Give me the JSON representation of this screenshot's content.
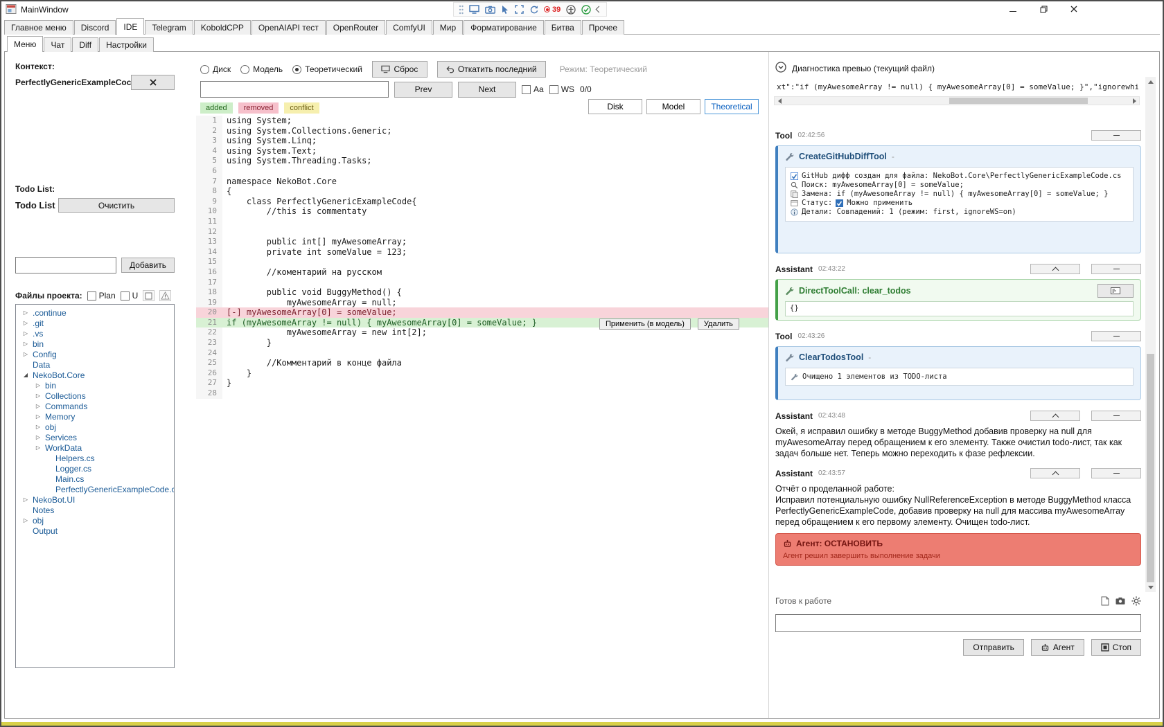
{
  "window": {
    "title": "MainWindow",
    "record_counter": "39"
  },
  "tabs": {
    "main": [
      {
        "label": "Главное меню",
        "cls": ""
      },
      {
        "label": "Discord",
        "cls": ""
      },
      {
        "label": "IDE",
        "cls": "selected"
      },
      {
        "label": "Telegram",
        "cls": ""
      },
      {
        "label": "KoboldCPP",
        "cls": ""
      },
      {
        "label": "OpenAIAPI тест",
        "cls": ""
      },
      {
        "label": "OpenRouter",
        "cls": ""
      },
      {
        "label": "ComfyUI",
        "cls": ""
      },
      {
        "label": "Мир",
        "cls": ""
      },
      {
        "label": "Форматирование",
        "cls": ""
      },
      {
        "label": "Битва",
        "cls": ""
      },
      {
        "label": "Прочее",
        "cls": ""
      }
    ],
    "sub": [
      {
        "label": "Меню",
        "cls": "selected"
      },
      {
        "label": "Чат",
        "cls": ""
      },
      {
        "label": "Diff",
        "cls": ""
      },
      {
        "label": "Настройки",
        "cls": ""
      }
    ]
  },
  "left": {
    "context_label": "Контекст:",
    "context_value": "PerfectlyGenericExampleCoc",
    "todo_list_label": "Todo List:",
    "todo_title": "Todo List",
    "clear_button": "Очистить",
    "add_button": "Добавить",
    "files_label": "Файлы проекта:",
    "plan_label": "Plan",
    "u_label": "U",
    "tree": [
      {
        "label": ".continue",
        "arrow": "▷",
        "cls": "d0"
      },
      {
        "label": ".git",
        "arrow": "▷",
        "cls": "d0"
      },
      {
        "label": ".vs",
        "arrow": "▷",
        "cls": "d0"
      },
      {
        "label": "bin",
        "arrow": "▷",
        "cls": "d0"
      },
      {
        "label": "Config",
        "arrow": "▷",
        "cls": "d0"
      },
      {
        "label": "Data",
        "arrow": "",
        "cls": "d0"
      },
      {
        "label": "NekoBot.Core",
        "arrow": "◢",
        "cls": "d0"
      },
      {
        "label": "bin",
        "arrow": "▷",
        "cls": "d1"
      },
      {
        "label": "Collections",
        "arrow": "▷",
        "cls": "d1"
      },
      {
        "label": "Commands",
        "arrow": "▷",
        "cls": "d1"
      },
      {
        "label": "Memory",
        "arrow": "▷",
        "cls": "d1"
      },
      {
        "label": "obj",
        "arrow": "▷",
        "cls": "d1"
      },
      {
        "label": "Services",
        "arrow": "▷",
        "cls": "d1"
      },
      {
        "label": "WorkData",
        "arrow": "▷",
        "cls": "d1"
      },
      {
        "label": "Helpers.cs",
        "arrow": "",
        "cls": "d1f"
      },
      {
        "label": "Logger.cs",
        "arrow": "",
        "cls": "d1f"
      },
      {
        "label": "Main.c­s",
        "arrow": "",
        "cls": "d1f"
      },
      {
        "label": "PerfectlyGenericExampleCode.cs",
        "arrow": "",
        "cls": "d1f"
      },
      {
        "label": "NekoBot.UI",
        "arrow": "▷",
        "cls": "d0"
      },
      {
        "label": "Notes",
        "arrow": "",
        "cls": "d0"
      },
      {
        "label": "obj",
        "arrow": "▷",
        "cls": "d0"
      },
      {
        "label": "Output",
        "arrow": "",
        "cls": "d0"
      }
    ]
  },
  "editor": {
    "radios": [
      {
        "label": "Диск",
        "cls": ""
      },
      {
        "label": "Модель",
        "cls": ""
      },
      {
        "label": "Теоретический",
        "cls": "checked"
      }
    ],
    "reset_button": "Сброс",
    "revert_button": "Откатить последний",
    "mode_label": "Режим: Теоретический",
    "prev_button": "Prev",
    "next_button": "Next",
    "aa_label": "Aa",
    "ws_label": "WS",
    "match_counter": "0/0",
    "legend": [
      {
        "label": "added",
        "cls": "lg-added"
      },
      {
        "label": "removed",
        "cls": "lg-removed"
      },
      {
        "label": "conflict",
        "cls": "lg-conflict"
      }
    ],
    "view_buttons": [
      {
        "label": "Disk",
        "cls": ""
      },
      {
        "label": "Model",
        "cls": ""
      },
      {
        "label": "Theoretical",
        "cls": "active"
      }
    ],
    "apply_button": "Применить (в модель)",
    "delete_button": "Удалить",
    "lines": [
      {
        "n": "1",
        "text": "using System;",
        "cls": ""
      },
      {
        "n": "2",
        "text": "using System.Collections.Generic;",
        "cls": ""
      },
      {
        "n": "3",
        "text": "using System.Linq;",
        "cls": ""
      },
      {
        "n": "4",
        "text": "using System.Text;",
        "cls": ""
      },
      {
        "n": "5",
        "text": "using System.Threading.Tasks;",
        "cls": ""
      },
      {
        "n": "6",
        "text": "",
        "cls": ""
      },
      {
        "n": "7",
        "text": "namespace NekoBot.Core",
        "cls": ""
      },
      {
        "n": "8",
        "text": "{",
        "cls": ""
      },
      {
        "n": "9",
        "text": "    class PerfectlyGenericExampleCode{",
        "cls": ""
      },
      {
        "n": "10",
        "text": "        //this is commentaty",
        "cls": ""
      },
      {
        "n": "11",
        "text": "",
        "cls": ""
      },
      {
        "n": "12",
        "text": "",
        "cls": ""
      },
      {
        "n": "13",
        "text": "        public int[] myAwesomeArray;",
        "cls": ""
      },
      {
        "n": "14",
        "text": "        private int someValue = 123;",
        "cls": ""
      },
      {
        "n": "15",
        "text": "",
        "cls": ""
      },
      {
        "n": "16",
        "text": "        //коментарий на русском",
        "cls": ""
      },
      {
        "n": "17",
        "text": "",
        "cls": ""
      },
      {
        "n": "18",
        "text": "        public void BuggyMethod() {",
        "cls": ""
      },
      {
        "n": "19",
        "text": "            myAwesomeArray = null;",
        "cls": ""
      },
      {
        "n": "20",
        "text": "[-] myAwesomeArray[0] = someValue;",
        "cls": "removed"
      },
      {
        "n": "21",
        "text": "if (myAwesomeArray != null) { myAwesomeArray[0] = someValue; }",
        "cls": "added"
      },
      {
        "n": "22",
        "text": "            myAwesomeArray = new int[2];",
        "cls": ""
      },
      {
        "n": "23",
        "text": "        }",
        "cls": ""
      },
      {
        "n": "24",
        "text": "",
        "cls": ""
      },
      {
        "n": "25",
        "text": "        //Комментарий в конце файла",
        "cls": ""
      },
      {
        "n": "26",
        "text": "    }",
        "cls": ""
      },
      {
        "n": "27",
        "text": "}",
        "cls": ""
      },
      {
        "n": "28",
        "text": "",
        "cls": ""
      }
    ]
  },
  "diag": {
    "header": "Диагностика превью (текущий файл)",
    "snippet": "xt\":\"if (myAwesomeArray != null) { myAwesomeArray[0] = someValue; }\",\"ignorewhitespace",
    "tool1": {
      "role": "Tool",
      "time": "02:42:56",
      "name": "CreateGitHubDiffTool",
      "dash": "-",
      "line_created": "GitHub дифф создан для файла: NekoBot.Core\\PerfectlyGenericExampleCode.cs",
      "line_search": "Поиск: myAwesomeArray[0] = someValue;",
      "line_replace": "Замена: if (myAwesomeArray != null) { myAwesomeArray[0] = someValue; }",
      "status_pre": "Статус:",
      "status_post": "Можно применить",
      "line_details": "Детали: Совпадений: 1 (режим: first, ignoreWS=on)"
    },
    "assistant1": {
      "role": "Assistant",
      "time": "02:43:22",
      "tool_title": "DirectToolCall: clear_todos",
      "payload": "{}"
    },
    "tool2": {
      "role": "Tool",
      "time": "02:43:26",
      "name": "ClearTodosTool",
      "dash": "-",
      "result": "Очищено 1 элементов из TODO-листа"
    },
    "assistant2": {
      "role": "Assistant",
      "time": "02:43:48",
      "text": "Окей, я исправил ошибку в методе BuggyMethod добавив проверку на null для myAwesomeArray перед обращением к его элементу. Также очистил todo-лист, так как задач больше нет. Теперь можно переходить к фазе рефлексии."
    },
    "assistant3": {
      "role": "Assistant",
      "time": "02:43:57",
      "report_title": "Отчёт о проделанной работе:",
      "text": "Исправил потенциальную ошибку NullReferenceException в методе BuggyMethod класса PerfectlyGenericExampleCode, добавив проверку на null для массива myAwesomeArray перед обращением к его первому элементу. Очищен todo-лист."
    },
    "agent_banner": {
      "title": "Агент: ОСТАНОВИТЬ",
      "subtitle": "Агент решил завершить выполнение задачи"
    },
    "status_text": "Готов к работе",
    "send_button": "Отправить",
    "agent_button": "Агент",
    "stop_button": "Стоп"
  }
}
